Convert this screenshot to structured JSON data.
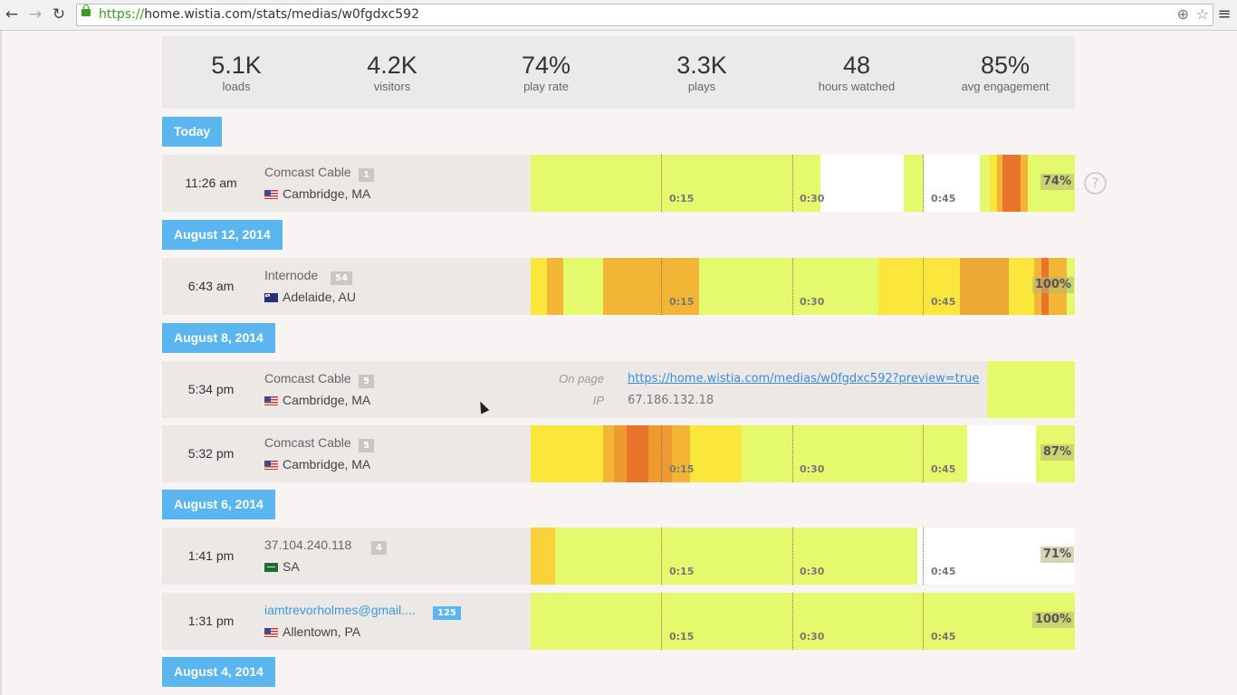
{
  "browser": {
    "url_scheme": "https://",
    "url_rest": "home.wistia.com/stats/medias/w0fgdxc592",
    "back_icon": "←",
    "forward_icon": "→",
    "reload_icon": "↻",
    "zoom_icon": "⊕",
    "star_icon": "☆",
    "menu_icon": "≡"
  },
  "summary": [
    {
      "value": "5.1K",
      "label": "loads"
    },
    {
      "value": "4.2K",
      "label": "visitors"
    },
    {
      "value": "74%",
      "label": "play rate"
    },
    {
      "value": "3.3K",
      "label": "plays"
    },
    {
      "value": "48",
      "label": "hours watched"
    },
    {
      "value": "85%",
      "label": "avg engagement"
    }
  ],
  "dates": [
    "Today",
    "August 12, 2014",
    "August 8, 2014",
    "August 6, 2014",
    "August 4, 2014"
  ],
  "tick_labels": [
    "0:15",
    "0:30",
    "0:45"
  ],
  "help_icon": "?",
  "sessions": [
    {
      "time": "11:26 am",
      "isp": "Comcast Cable",
      "count": "1",
      "location": "Cambridge, MA",
      "percent": "74%"
    },
    {
      "time": "6:43 am",
      "isp": "Internode",
      "count": "54",
      "location": "Adelaide, AU",
      "percent": "100%"
    },
    {
      "time": "5:34 pm",
      "isp": "Comcast Cable",
      "count": "5",
      "location": "Cambridge, MA",
      "on_page_label": "On page",
      "on_page_value": "https://home.wistia.com/medias/w0fgdxc592?preview=true",
      "ip_label": "IP",
      "ip_value": "67.186.132.18"
    },
    {
      "time": "5:32 pm",
      "isp": "Comcast Cable",
      "count": "5",
      "location": "Cambridge, MA",
      "percent": "87%"
    },
    {
      "time": "1:41 pm",
      "isp": "37.104.240.118",
      "count": "4",
      "location": "SA",
      "percent": "71%"
    },
    {
      "time": "1:31 pm",
      "isp": "iamtrevorholmes@gmail....",
      "count": "125",
      "location": "Allentown, PA",
      "percent": "100%"
    }
  ],
  "colors": {
    "accent": "#5bb6f0",
    "heat_low": "#e4fa6c",
    "heat_mid": "#fbe63c",
    "heat_high": "#f2b535",
    "heat_max": "#e8752a"
  }
}
